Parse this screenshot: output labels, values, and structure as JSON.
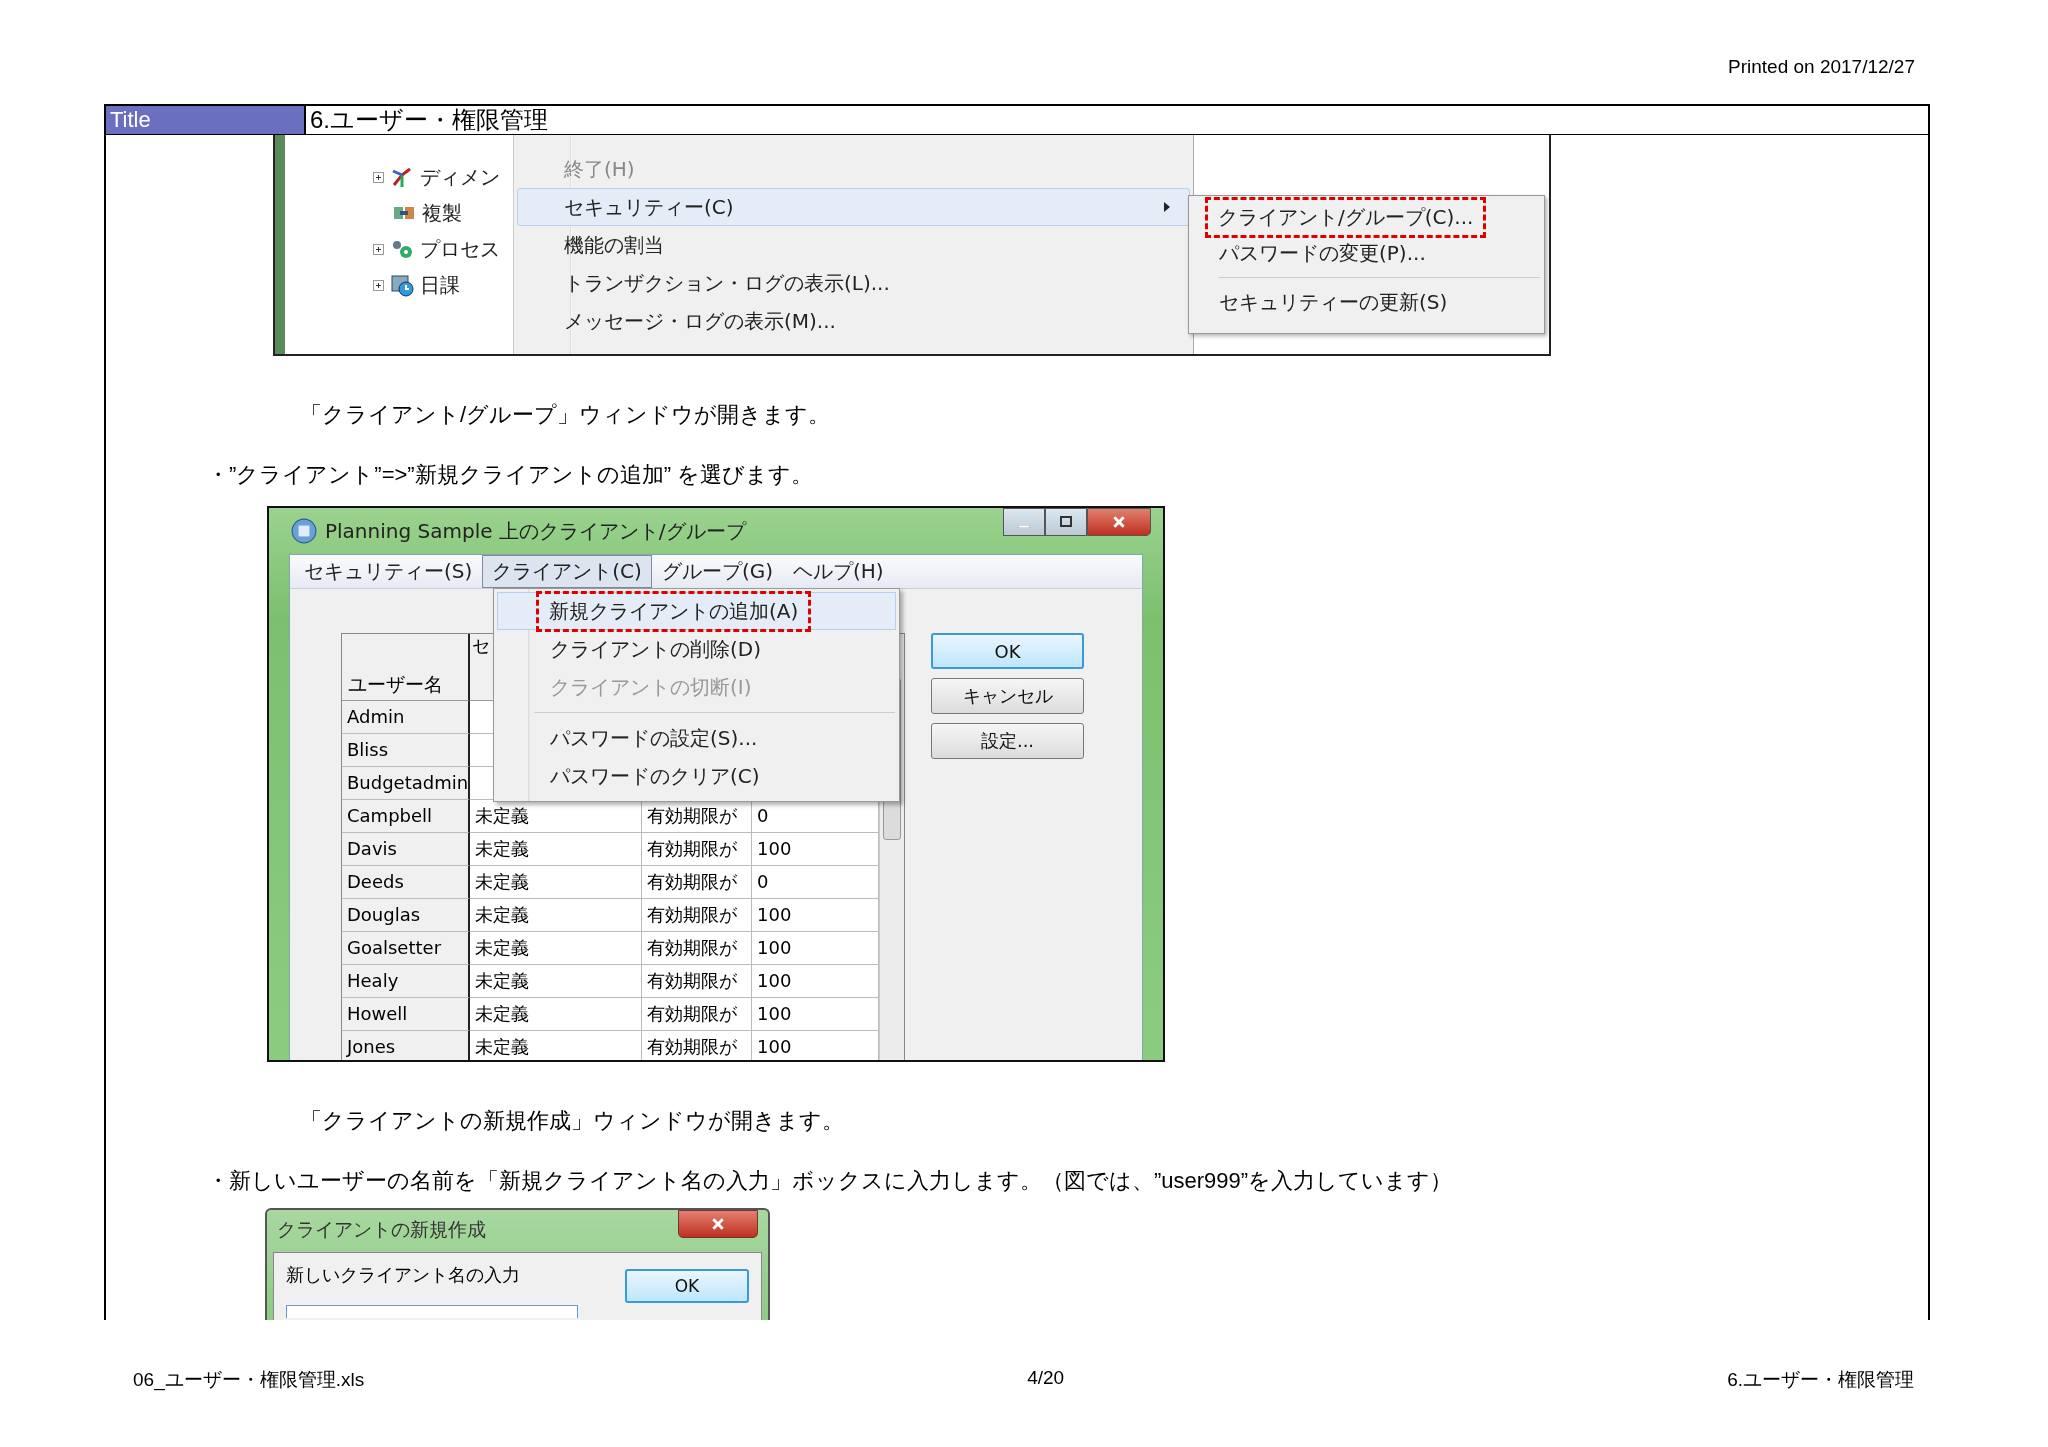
{
  "header": {
    "printed_on": "Printed on 2017/12/27"
  },
  "title_row": {
    "label": "Title",
    "value": "6.ユーザー・権限管理"
  },
  "screenshot_1": {
    "tree": [
      {
        "label": "ディメン",
        "kind": "dimension",
        "expandable": true
      },
      {
        "label": "複製",
        "kind": "copy",
        "expandable": false
      },
      {
        "label": "プロセス",
        "kind": "process",
        "expandable": true
      },
      {
        "label": "日課",
        "kind": "schedule",
        "expandable": true
      }
    ],
    "menu": [
      {
        "label": "終了(H)",
        "disabled": true,
        "selected": false,
        "submenu": false
      },
      {
        "label": "セキュリティー(C)",
        "disabled": false,
        "selected": true,
        "submenu": true
      },
      {
        "label": "機能の割当",
        "disabled": false,
        "selected": false,
        "submenu": false
      },
      {
        "label": "トランザクション・ログの表示(L)...",
        "disabled": false,
        "selected": false,
        "submenu": false
      },
      {
        "label": "メッセージ・ログの表示(M)...",
        "disabled": false,
        "selected": false,
        "submenu": false
      }
    ],
    "submenu": [
      {
        "kind": "item",
        "label": "クライアント/グループ(C)...",
        "annotated": true
      },
      {
        "kind": "item",
        "label": "パスワードの変更(P)...",
        "annotated": false
      },
      {
        "kind": "separator"
      },
      {
        "kind": "item",
        "label": "セキュリティーの更新(S)",
        "annotated": false
      }
    ]
  },
  "notes": [
    {
      "kind": "note",
      "text": "「クライアント/グループ」ウィンドウが開きます。"
    },
    {
      "kind": "bullet",
      "text": "・”クライアント”=>”新規クライアントの追加” を選びます。"
    }
  ],
  "screenshot_2": {
    "title": "Planning Sample 上のクライアント/グループ",
    "menubar": [
      {
        "label": "セキュリティー(S)",
        "selected": false
      },
      {
        "label": "クライアント(C)",
        "selected": true
      },
      {
        "label": "グループ(G)",
        "selected": false
      },
      {
        "label": "ヘルプ(H)",
        "selected": false
      }
    ],
    "dropdown": [
      {
        "kind": "item",
        "label": "新規クライアントの追加(A)",
        "selected": true,
        "disabled": false,
        "annotated": true
      },
      {
        "kind": "item",
        "label": "クライアントの削除(D)",
        "selected": false,
        "disabled": false,
        "annotated": false
      },
      {
        "kind": "item",
        "label": "クライアントの切断(I)",
        "selected": false,
        "disabled": true,
        "annotated": false
      },
      {
        "kind": "separator"
      },
      {
        "kind": "item",
        "label": "パスワードの設定(S)...",
        "selected": false,
        "disabled": false,
        "annotated": false
      },
      {
        "kind": "item",
        "label": "パスワードのクリア(C)",
        "selected": false,
        "disabled": false,
        "annotated": false
      }
    ],
    "table": {
      "columns": [
        "ユーザー名",
        "セ"
      ],
      "rows": [
        {
          "cells": [
            "Admin"
          ]
        },
        {
          "cells": [
            "Bliss"
          ]
        },
        {
          "cells": [
            "Budgetadmin"
          ]
        },
        {
          "cells": [
            "Campbell",
            "未定義",
            "有効期限が",
            "0"
          ]
        },
        {
          "cells": [
            "Davis",
            "未定義",
            "有効期限が",
            "100"
          ]
        },
        {
          "cells": [
            "Deeds",
            "未定義",
            "有効期限が",
            "0"
          ]
        },
        {
          "cells": [
            "Douglas",
            "未定義",
            "有効期限が",
            "100"
          ]
        },
        {
          "cells": [
            "Goalsetter",
            "未定義",
            "有効期限が",
            "100"
          ]
        },
        {
          "cells": [
            "Healy",
            "未定義",
            "有効期限が",
            "100"
          ]
        },
        {
          "cells": [
            "Howell",
            "未定義",
            "有効期限が",
            "100"
          ]
        },
        {
          "cells": [
            "Jones",
            "未定義",
            "有効期限が",
            "100"
          ]
        }
      ]
    },
    "buttons": [
      {
        "label": "OK",
        "default": true
      },
      {
        "label": "キャンセル",
        "default": false
      },
      {
        "label": "設定...",
        "default": false
      }
    ]
  },
  "notes_2": [
    {
      "kind": "note",
      "text": "「クライアントの新規作成」ウィンドウが開きます。"
    },
    {
      "kind": "bullet",
      "text": "・新しいユーザーの名前を「新規クライアント名の入力」ボックスに入力します。（図では、”user999”を入力しています）"
    }
  ],
  "screenshot_3": {
    "title": "クライアントの新規作成",
    "label": "新しいクライアント名の入力",
    "button": "OK"
  },
  "footer": {
    "left": "06_ユーザー・権限管理.xls",
    "center": "4/20",
    "right": "6.ユーザー・権限管理"
  }
}
